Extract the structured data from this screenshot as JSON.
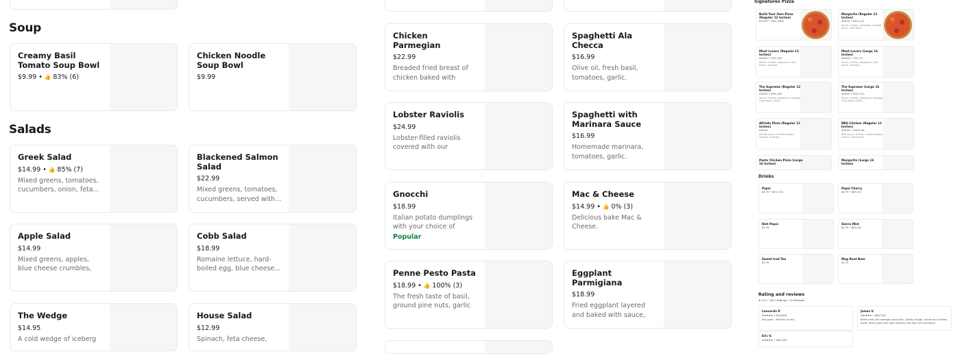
{
  "sections": {
    "soup": "Soup",
    "salads": "Salads"
  },
  "col1": [
    {
      "name": "Creamy Basil Tomato Soup Bowl",
      "price": "$9.99",
      "rating": "83% (6)",
      "desc": ""
    },
    {
      "name": "Chicken Noodle Soup Bowl",
      "price": "$9.99",
      "rating": "",
      "desc": ""
    },
    {
      "name": "Greek Salad",
      "price": "$14.99",
      "rating": "85% (7)",
      "desc": "Mixed greens, tomatoes, cucumbers, onion, feta..."
    },
    {
      "name": "Blackened Salmon Salad",
      "price": "$22.99",
      "rating": "",
      "desc": "Mixed greens, tomatoes, cucumbers, served with..."
    },
    {
      "name": "Apple Salad",
      "price": "$14.99",
      "rating": "",
      "desc": "Mixed greens, apples, blue cheese crumbles, dried..."
    },
    {
      "name": "Cobb Salad",
      "price": "$18.99",
      "rating": "",
      "desc": "Romaine lettuce, hard-boiled egg, blue cheese..."
    },
    {
      "name": "The Wedge",
      "price": "$14.95",
      "rating": "",
      "desc": "A cold wedge of iceberg"
    },
    {
      "name": "House Salad",
      "price": "$12.99",
      "rating": "",
      "desc": "Spinach, feta cheese,"
    }
  ],
  "col2": [
    {
      "name": "Chicken Parmegian",
      "price": "$22.99",
      "rating": "",
      "desc": "Breaded fried breast of chicken baked with meat...",
      "popular": ""
    },
    {
      "name": "Spaghetti Ala Checca",
      "price": "$16.99",
      "rating": "",
      "desc": "Olive oil, fresh basil, tomatoes, garlic.",
      "popular": ""
    },
    {
      "name": "Lobster Raviolis",
      "price": "$24.99",
      "rating": "",
      "desc": "Lobster-filled raviolis covered with our homemad...",
      "popular": ""
    },
    {
      "name": "Spaghetti with Marinara Sauce",
      "price": "$16.99",
      "rating": "",
      "desc": "Homemade marinara, tomatoes, garlic.",
      "popular": ""
    },
    {
      "name": "Gnocchi",
      "price": "$18.99",
      "rating": "",
      "desc": "Italian potato dumplings with your choice of sauce.",
      "popular": "Popular"
    },
    {
      "name": "Mac & Cheese",
      "price": "$14.99",
      "rating": "0% (3)",
      "desc": "Delicious bake Mac & Cheese.",
      "popular": ""
    },
    {
      "name": "Penne Pesto Pasta",
      "price": "$18.99",
      "rating": "100% (3)",
      "desc": "The fresh taste of basil, ground pine nuts, garlic an...",
      "popular": ""
    },
    {
      "name": "Eggplant Parmigiana",
      "price": "$18.99",
      "rating": "",
      "desc": "Fried eggplant layered and baked with sauce, Romano...",
      "popular": ""
    }
  ],
  "right_panel": {
    "signatures_title": "Signatures Pizza",
    "pizzas": [
      {
        "name": "Build Your Own Pizza (Regular 12 Inches)",
        "meta": "$19.99 • 79% (209)",
        "desc": ""
      },
      {
        "name": "Margarita (Regular 12 Inches)",
        "meta": "$18.50 • 85% (12)",
        "desc": "Sauce, cheese, tomatoes, crushed garlic, fresh basil."
      },
      {
        "name": "Meat Lovers (Regular 12 Inches)",
        "meta": "$18.50 • 72% (32)",
        "desc": "Sauce, cheese, pepperoni, ham, bacon, sausage."
      },
      {
        "name": "Meat Lovers (Large 16 Inches)",
        "meta": "$28.50 • 71% (7)",
        "desc": "Sauce, cheese, pepperoni, ham, bacon, sausage."
      },
      {
        "name": "The Supreme (Regular 12 Inches)",
        "meta": "$18.50 • 90% (20)",
        "desc": "Sauce, cheese, pepperoni, sausage, crisp bacon, olive..."
      },
      {
        "name": "The Supreme (Large 16 Inches)",
        "meta": "$28.50 • 90% (11)",
        "desc": "Sauce, cheese, pepperoni, sausage, crisp bacon, olive..."
      },
      {
        "name": "Alfredo Pizza (Regular 12 Inches)",
        "meta": "$18.50",
        "desc": "Alfredo sauce, chicken breast, spinach, crushed..."
      },
      {
        "name": "BBQ Chicken (Regular 12 Inches)",
        "meta": "$18.50 • 100% (8)",
        "desc": "BBQ sauce, cheese, chicken breast, onions, crispy baco..."
      },
      {
        "name": "Pesto Chicken Pizza (Large 16 Inches)",
        "meta": "",
        "desc": ""
      },
      {
        "name": "Margarita (Large 16 Inches)",
        "meta": "",
        "desc": ""
      }
    ],
    "drinks_title": "Drinks",
    "drinks": [
      {
        "name": "Pepsi",
        "meta": "$3.75 • 81% (11)"
      },
      {
        "name": "Pepsi Cherry",
        "meta": "$3.75 • 60% (5)"
      },
      {
        "name": "Diet Pepsi",
        "meta": "$3.75"
      },
      {
        "name": "Sierra Mist",
        "meta": "$3.75 • 60% (5)"
      },
      {
        "name": "Sweet Iced Tea",
        "meta": "$3.75"
      },
      {
        "name": "Mug Root Beer",
        "meta": "$3.75"
      }
    ],
    "reviews_title": "Rating and reviews",
    "reviews_summary": "★ 4.5 • 100+ Ratings • 25 Reviews",
    "reviews": [
      {
        "name": "Leonardo P.",
        "stars": "★★★★★ • 09/18/24",
        "text": "Alls good - delivery so fast"
      },
      {
        "name": "James V.",
        "stars": "★★★★★ • 08/17/24",
        "text": "Better than the average pizza joint. Quality dough, meats and cheese. really. Really good and uber delivery was fast and courteous."
      },
      {
        "name": "Eric V.",
        "stars": "★★★★★ • 08/12/24",
        "text": ""
      }
    ]
  }
}
